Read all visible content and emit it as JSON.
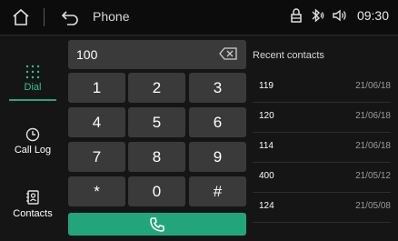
{
  "topbar": {
    "title": "Phone",
    "time": "09:30",
    "icons": [
      "home-icon",
      "back-icon",
      "lock-icon",
      "bluetooth-icon",
      "volume-icon"
    ]
  },
  "sidebar": {
    "items": [
      {
        "label": "Dial",
        "icon": "dialpad-icon",
        "active": true
      },
      {
        "label": "Call Log",
        "icon": "clock-icon",
        "active": false
      },
      {
        "label": "Contacts",
        "icon": "contacts-icon",
        "active": false
      }
    ]
  },
  "dialer": {
    "input_value": "100",
    "keys": [
      "1",
      "2",
      "3",
      "4",
      "5",
      "6",
      "7",
      "8",
      "9",
      "*",
      "0",
      "#"
    ],
    "call_icon": "phone-icon"
  },
  "recent": {
    "title": "Recent contacts",
    "rows": [
      {
        "number": "119",
        "date": "21/06/18"
      },
      {
        "number": "120",
        "date": "21/06/18"
      },
      {
        "number": "114",
        "date": "21/06/18"
      },
      {
        "number": "400",
        "date": "21/05/12"
      },
      {
        "number": "124",
        "date": "21/05/08"
      }
    ]
  },
  "colors": {
    "accent": "#23a57b",
    "accent_text": "#2fc593",
    "key_bg": "#3a3a3a",
    "background": "#151515"
  }
}
